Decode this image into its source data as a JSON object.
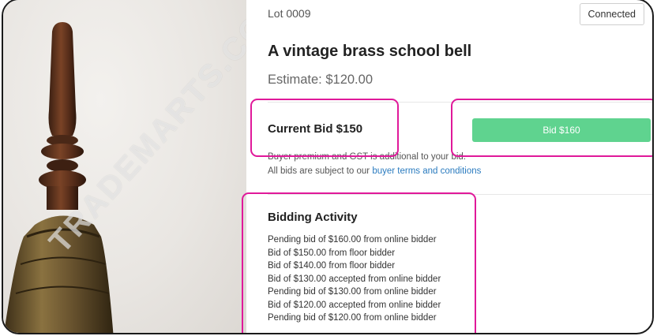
{
  "status": {
    "connection_label": "Connected"
  },
  "lot": {
    "number_label": "Lot 0009",
    "title": "A vintage brass school bell",
    "estimate_label": "Estimate: $120.00",
    "image_watermark": "TRADEMARTS.CO.NZ"
  },
  "bidding": {
    "current_bid_label": "Current Bid $150",
    "bid_button_label": "Bid $160",
    "note_premium": "Buyer premium and GST is additional to your bid.",
    "note_terms_prefix": "All bids are subject to our ",
    "note_terms_link": "buyer terms and conditions"
  },
  "activity": {
    "title": "Bidding Activity",
    "items": [
      "Pending bid of $160.00 from online bidder",
      "Bid of $150.00 from floor bidder",
      "Bid of $140.00 from floor bidder",
      "Bid of $130.00 accepted from online bidder",
      "Pending bid of $130.00 from online bidder",
      "Bid of $120.00 accepted from online bidder",
      "Pending bid of $120.00 from online bidder"
    ]
  },
  "colors": {
    "bid_button": "#5fd38f",
    "highlight_outline": "#e0199a",
    "link": "#2a7bbf"
  }
}
